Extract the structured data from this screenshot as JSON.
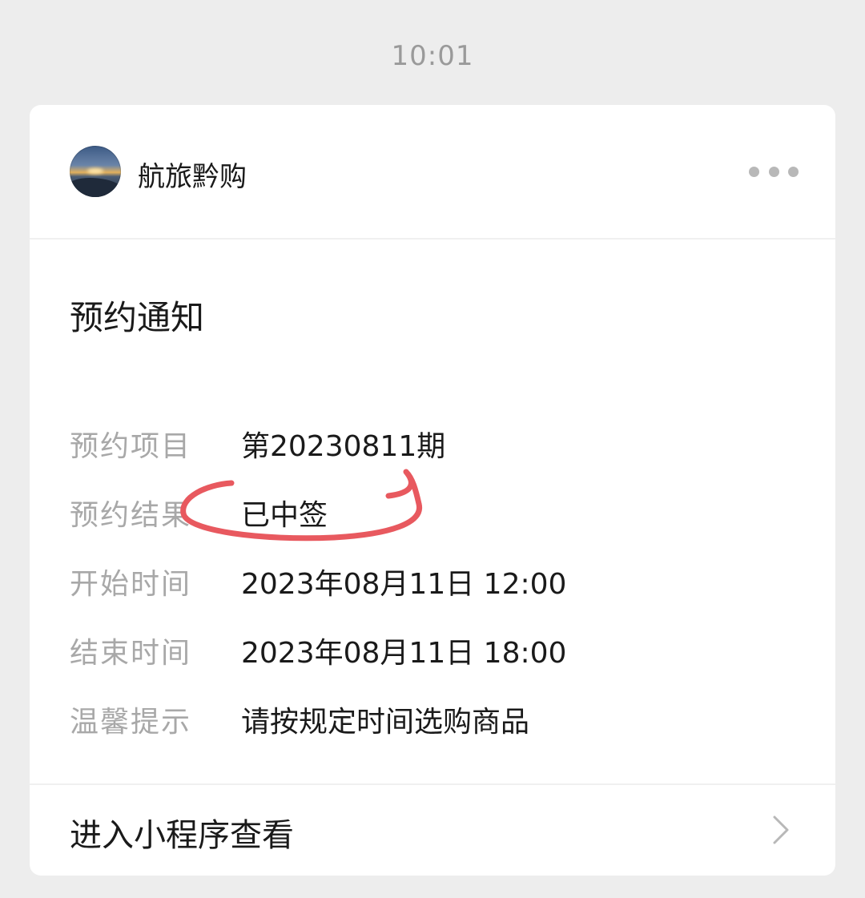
{
  "status_time": "10:01",
  "card": {
    "account_name": "航旅黔购",
    "avatar_icon": "sunset-avatar-icon",
    "more_icon": "more-dots-icon",
    "title": "预约通知",
    "rows": [
      {
        "label": "预约项目",
        "value": "第20230811期"
      },
      {
        "label": "预约结果",
        "value": "已中签"
      },
      {
        "label": "开始时间",
        "value": "2023年08月11日 12:00"
      },
      {
        "label": "结束时间",
        "value": "2023年08月11日 18:00"
      },
      {
        "label": "温馨提示",
        "value": "请按规定时间选购商品"
      }
    ],
    "annotation_color": "#e8595f",
    "footer_label": "进入小程序查看",
    "chevron_icon": "chevron-right-icon"
  }
}
